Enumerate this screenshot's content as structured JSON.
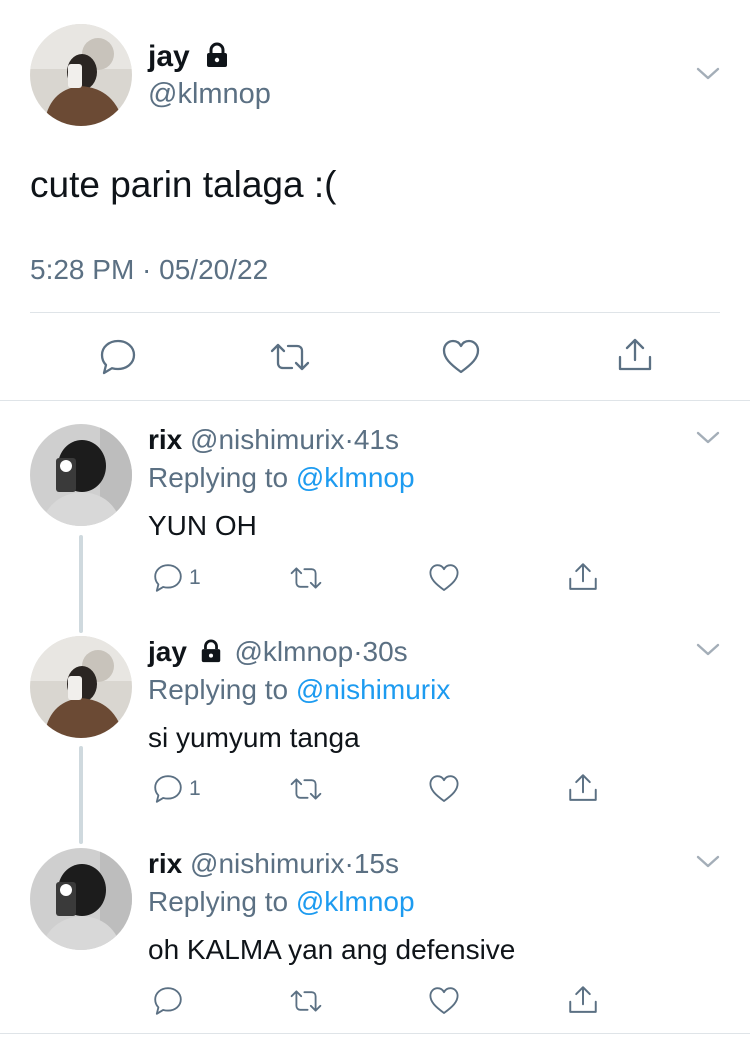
{
  "main_tweet": {
    "name": "jay",
    "handle": "@klmnop",
    "text": "cute parin talaga :(",
    "timestamp": "5:28 PM · 05/20/22",
    "locked": true
  },
  "replies": [
    {
      "name": "rix",
      "handle": "@nishimurix",
      "time": "41s",
      "replying_prefix": "Replying to",
      "replying_to": "@klmnop",
      "text": "YUN OH",
      "reply_count": "1"
    },
    {
      "name": "jay",
      "handle": "@klmnop",
      "time": "30s",
      "replying_prefix": "Replying to",
      "replying_to": "@nishimurix",
      "text": "si yumyum tanga",
      "reply_count": "1",
      "locked": true
    },
    {
      "name": "rix",
      "handle": "@nishimurix",
      "time": "15s",
      "replying_prefix": "Replying to",
      "replying_to": "@klmnop",
      "text": "oh KALMA yan ang defensive",
      "reply_count": ""
    }
  ],
  "separator": "·",
  "icons": [
    "reply-icon",
    "retweet-icon",
    "like-icon",
    "share-icon",
    "lock-icon",
    "chevron-down-icon"
  ],
  "colors": {
    "link": "#1d9bf0",
    "secondary_text": "#5b7083",
    "divider": "#dfe4e8"
  }
}
